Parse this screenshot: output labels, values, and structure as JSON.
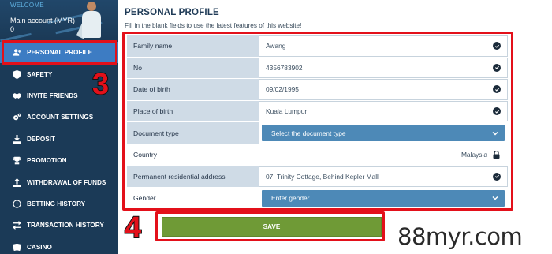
{
  "sidebar": {
    "welcome": "WELCOME",
    "account_label": "Main account (MYR)",
    "account_balance": "0",
    "items": [
      {
        "label": "PERSONAL PROFILE",
        "icon": "add-user-icon",
        "active": true
      },
      {
        "label": "SAFETY",
        "icon": "shield-icon"
      },
      {
        "label": "INVITE FRIENDS",
        "icon": "handshake-icon"
      },
      {
        "label": "ACCOUNT SETTINGS",
        "icon": "gears-icon"
      },
      {
        "label": "DEPOSIT",
        "icon": "download-icon"
      },
      {
        "label": "PROMOTION",
        "icon": "trophy-icon"
      },
      {
        "label": "WITHDRAWAL OF FUNDS",
        "icon": "upload-icon"
      },
      {
        "label": "BETTING HISTORY",
        "icon": "history-icon"
      },
      {
        "label": "TRANSACTION HISTORY",
        "icon": "transfer-icon"
      },
      {
        "label": "CASINO",
        "icon": "cards-icon"
      }
    ]
  },
  "main": {
    "title": "PERSONAL PROFILE",
    "subtitle": "Fill in the blank fields to use the latest features of this website!",
    "fields": {
      "family_name": {
        "label": "Family name",
        "value": "Awang"
      },
      "no": {
        "label": "No",
        "value": "4356783902"
      },
      "date_of_birth": {
        "label": "Date of birth",
        "value": "09/02/1995"
      },
      "place_of_birth": {
        "label": "Place of birth",
        "value": "Kuala Lumpur"
      },
      "document_type": {
        "label": "Document type",
        "value": "Select the document type"
      },
      "country": {
        "label": "Country",
        "value": "Malaysia"
      },
      "address": {
        "label": "Permanent residential address",
        "value": "07, Trinity Cottage, Behind Kepler Mall"
      },
      "gender": {
        "label": "Gender",
        "value": "Enter gender"
      }
    },
    "save_label": "SAVE"
  },
  "annotations": {
    "step3": "3",
    "step4": "4",
    "highlight_color": "#e3101a"
  },
  "watermark": "88myr.com",
  "colors": {
    "sidebar_bg": "#1b3a57",
    "active_item": "#3d7cc3",
    "select_bg": "#4d89b7",
    "save_bg": "#6f9a36",
    "label_bg": "#cfdbe6"
  }
}
